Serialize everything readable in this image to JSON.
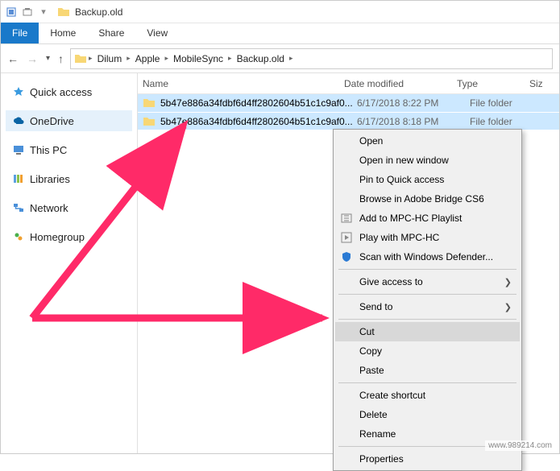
{
  "title": "Backup.old",
  "ribbon": {
    "file": "File",
    "home": "Home",
    "share": "Share",
    "view": "View"
  },
  "breadcrumb": [
    "Dilum",
    "Apple",
    "MobileSync",
    "Backup.old"
  ],
  "sidebar": {
    "quick_access": "Quick access",
    "onedrive": "OneDrive",
    "this_pc": "This PC",
    "libraries": "Libraries",
    "network": "Network",
    "homegroup": "Homegroup"
  },
  "columns": {
    "name": "Name",
    "date": "Date modified",
    "type": "Type",
    "size": "Siz"
  },
  "rows": [
    {
      "name": "5b47e886a34fdbf6d4ff2802604b51c1c9af0...",
      "date": "6/17/2018 8:22 PM",
      "type": "File folder"
    },
    {
      "name": "5b47e886a34fdbf6d4ff2802604b51c1c9af0...",
      "date": "6/17/2018 8:18 PM",
      "type": "File folder"
    }
  ],
  "context_menu": {
    "open": "Open",
    "open_new": "Open in new window",
    "pin_qa": "Pin to Quick access",
    "bridge": "Browse in Adobe Bridge CS6",
    "mpc_add": "Add to MPC-HC Playlist",
    "mpc_play": "Play with MPC-HC",
    "defender": "Scan with Windows Defender...",
    "give_access": "Give access to",
    "send_to": "Send to",
    "cut": "Cut",
    "copy": "Copy",
    "paste": "Paste",
    "shortcut": "Create shortcut",
    "delete": "Delete",
    "rename": "Rename",
    "properties": "Properties"
  },
  "watermark": "www.989214.com"
}
